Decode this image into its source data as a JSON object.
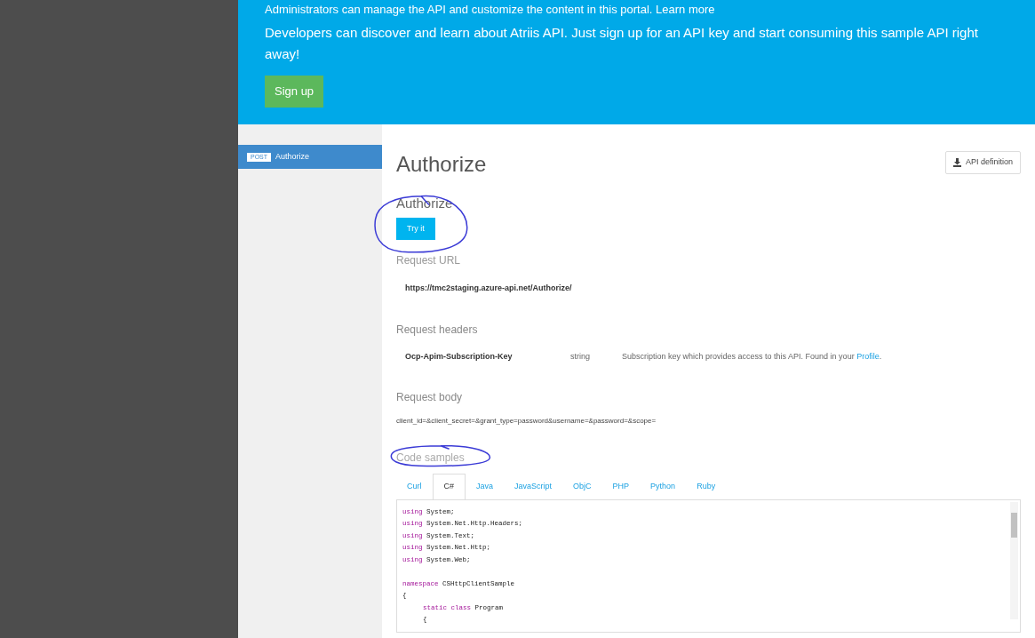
{
  "banner": {
    "admin_text": "Administrators can manage the API and customize the content in this portal. Learn more",
    "intro": "Developers can discover and learn about Atriis API. Just sign up for an API key and start consuming this sample API right away!",
    "signup_button": "Sign up"
  },
  "sidebar": {
    "items": [
      {
        "method": "POST",
        "label": "Authorize",
        "selected": true
      }
    ]
  },
  "operation": {
    "title": "Authorize",
    "definition_button": "API definition",
    "subtitle": "Authorize",
    "try_button": "Try it",
    "request_url_label": "Request URL",
    "request_url": "https://tmc2staging.azure-api.net/Authorize/",
    "headers_label": "Request headers",
    "headers": [
      {
        "name": "Ocp-Apim-Subscription-Key",
        "type": "string",
        "description": "Subscription key which provides access to this API. Found in your ",
        "link": "Profile",
        "after": "."
      }
    ],
    "body_label": "Request body",
    "body": "client_id=&client_secret=&grant_type=password&username=&password=&scope=",
    "code_samples_label": "Code samples",
    "tabs": [
      {
        "label": "Curl",
        "selected": false
      },
      {
        "label": "C#",
        "selected": true
      },
      {
        "label": "Java",
        "selected": false
      },
      {
        "label": "JavaScript",
        "selected": false
      },
      {
        "label": "ObjC",
        "selected": false
      },
      {
        "label": "PHP",
        "selected": false
      },
      {
        "label": "Python",
        "selected": false
      },
      {
        "label": "Ruby",
        "selected": false
      }
    ],
    "code_lines": [
      {
        "kind": "code",
        "indented": false,
        "segments": [
          {
            "text": "using",
            "kind": "keyword"
          },
          {
            "text": "System;",
            "kind": "plain"
          }
        ]
      },
      {
        "kind": "code",
        "indented": false,
        "segments": [
          {
            "text": "using",
            "kind": "keyword"
          },
          {
            "text": "System.Net.Http.Headers;",
            "kind": "plain"
          }
        ]
      },
      {
        "kind": "code",
        "indented": false,
        "segments": [
          {
            "text": "using",
            "kind": "keyword"
          },
          {
            "text": "System.Text;",
            "kind": "plain"
          }
        ]
      },
      {
        "kind": "code",
        "indented": false,
        "segments": [
          {
            "text": "using",
            "kind": "keyword"
          },
          {
            "text": "System.Net.Http;",
            "kind": "plain"
          }
        ]
      },
      {
        "kind": "code",
        "indented": false,
        "segments": [
          {
            "text": "using",
            "kind": "keyword"
          },
          {
            "text": "System.Web;",
            "kind": "plain"
          }
        ]
      },
      {
        "kind": "blank"
      },
      {
        "kind": "code",
        "indented": false,
        "segments": [
          {
            "text": "namespace",
            "kind": "keyword"
          },
          {
            "text": "CSHttpClientSample",
            "kind": "plain"
          }
        ]
      },
      {
        "kind": "code",
        "indented": false,
        "segments": [
          {
            "text": "{",
            "kind": "plain"
          }
        ]
      },
      {
        "kind": "code",
        "indented": true,
        "segments": [
          {
            "text": "static class",
            "kind": "keyword"
          },
          {
            "text": "Program",
            "kind": "plain"
          }
        ]
      },
      {
        "kind": "code",
        "indented": true,
        "segments": [
          {
            "text": "{",
            "kind": "plain"
          }
        ]
      }
    ]
  }
}
